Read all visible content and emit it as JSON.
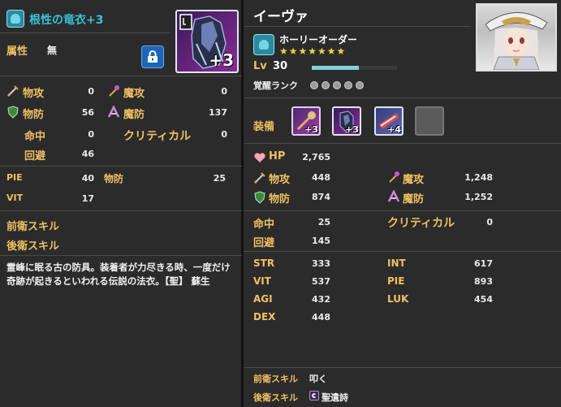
{
  "item": {
    "name": "根性の竜衣+3",
    "attribute_label": "属性",
    "attribute_value": "無",
    "plus_badge": "+3",
    "stats": {
      "patk": {
        "label": "物攻",
        "value": "0"
      },
      "matk": {
        "label": "魔攻",
        "value": "0"
      },
      "pdef": {
        "label": "物防",
        "value": "56"
      },
      "mdef": {
        "label": "魔防",
        "value": "137"
      },
      "hit": {
        "label": "命中",
        "value": "0"
      },
      "crit": {
        "label": "クリティカル",
        "value": "0"
      },
      "eva": {
        "label": "回避",
        "value": "46"
      }
    },
    "extra": {
      "pie_label": "PIE",
      "pie_value": "40",
      "pdef_req_label": "物防",
      "pdef_req_value": "25",
      "vit_label": "VIT",
      "vit_value": "17"
    },
    "front_skill_label": "前衛スキル",
    "back_skill_label": "後衛スキル",
    "description": "霊峰に眠る古の防具。装着者が力尽きる時、一度だけ奇跡が起きるといわれる伝説の法衣。【聖】 蘇生"
  },
  "character": {
    "name": "イーヴァ",
    "class": "ホーリーオーダー",
    "stars": "★★★★★★★",
    "level_label": "Lv",
    "level": "30",
    "exp_fraction": 0.55,
    "awaken_label": "覚醒ランク",
    "equip_label": "装備",
    "equip_plus": [
      "+3",
      "+3",
      "+4"
    ],
    "stats": {
      "hp_label": "HP",
      "hp": "2,765",
      "patk_label": "物攻",
      "patk": "448",
      "matk_label": "魔攻",
      "matk": "1,248",
      "pdef_label": "物防",
      "pdef": "874",
      "mdef_label": "魔防",
      "mdef": "1,252",
      "hit_label": "命中",
      "hit": "25",
      "crit_label": "クリティカル",
      "crit": "0",
      "eva_label": "回避",
      "eva": "145",
      "str_label": "STR",
      "str": "333",
      "int_label": "INT",
      "int": "617",
      "vit_label": "VIT",
      "vit": "537",
      "pie_label": "PIE",
      "pie": "893",
      "agi_label": "AGI",
      "agi": "432",
      "luk_label": "LUK",
      "luk": "454",
      "dex_label": "DEX",
      "dex": "448"
    },
    "front_skill_label": "前衛スキル",
    "front_skill": "叩く",
    "back_skill_label": "後衛スキル",
    "back_skill": "聖遺詩"
  },
  "colors": {
    "accent_teal": "#2fb8c9",
    "gold_label": "#f0c062",
    "panel_bg": "#2b2b2b"
  }
}
